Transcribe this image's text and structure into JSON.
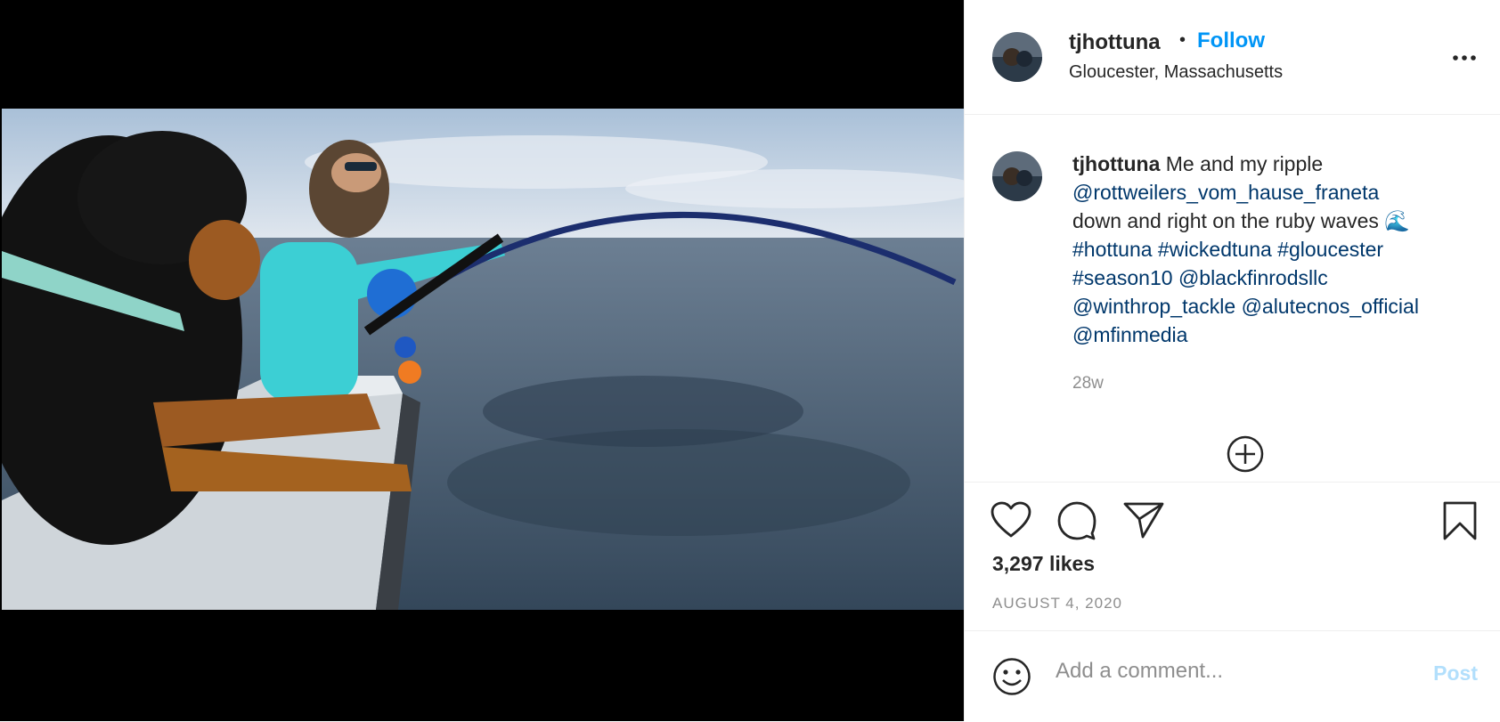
{
  "post": {
    "username": "tjhottuna",
    "follow_label": "Follow",
    "separator": "•",
    "location": "Gloucester, Massachusetts",
    "more_label": "...",
    "caption": {
      "username": "tjhottuna",
      "text_intro": " Me and my ripple",
      "mention_1": "@rottweilers_vom_hause_franeta",
      "text_middle": "down and right on the ruby waves 🌊",
      "tag_1": "#hottuna",
      "tag_2": "#wickedtuna",
      "tag_3": "#gloucester",
      "tag_4": "#season10",
      "mention_2": "@blackfinrodsllc",
      "mention_3": "@winthrop_tackle",
      "mention_4": "@alutecnos_official",
      "mention_5": "@mfinmedia"
    },
    "time_ago": "28w",
    "likes": "3,297 likes",
    "date": "AUGUST 4, 2020",
    "comment_placeholder": "Add a comment...",
    "post_label": "Post"
  },
  "colors": {
    "link_blue": "#0095f6",
    "tag_navy": "#00376b",
    "muted": "#8e8e8e",
    "post_disabled": "#b2dffc"
  },
  "icons": [
    "heart-icon",
    "comment-icon",
    "share-icon",
    "bookmark-icon",
    "more-options-icon",
    "load-more-icon",
    "emoji-icon"
  ]
}
